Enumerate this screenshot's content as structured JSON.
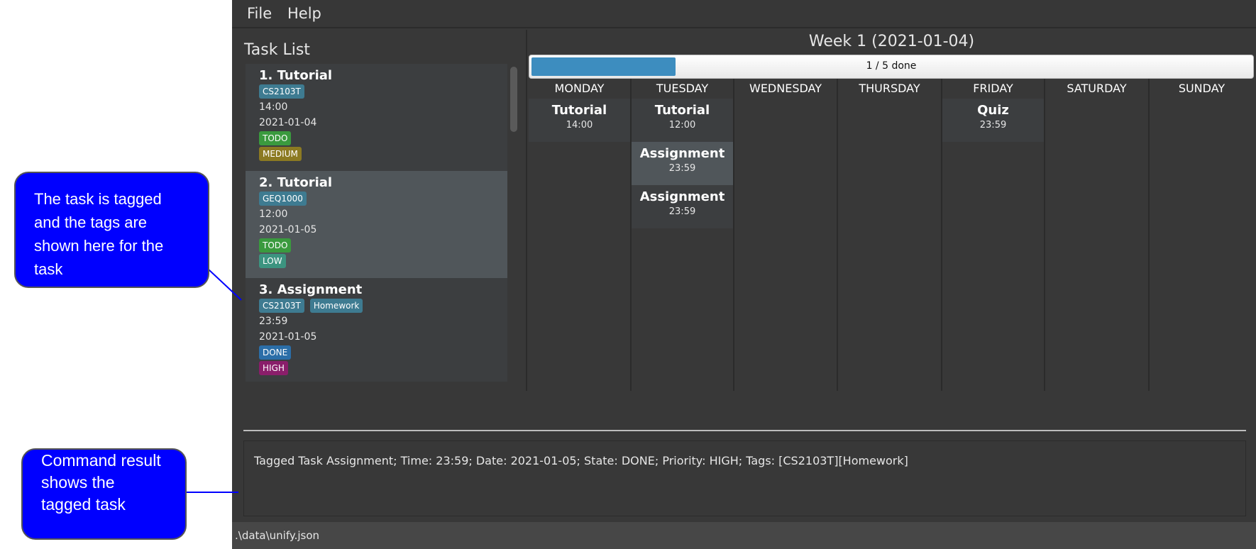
{
  "menu": {
    "file": "File",
    "help": "Help"
  },
  "task_list": {
    "title": "Task List",
    "tasks": [
      {
        "title": "1.  Tutorial",
        "tags": [
          "CS2103T"
        ],
        "time": "14:00",
        "date": "2021-01-04",
        "state": "TODO",
        "priority": "MEDIUM"
      },
      {
        "title": "2.  Tutorial",
        "tags": [
          "GEQ1000"
        ],
        "time": "12:00",
        "date": "2021-01-05",
        "state": "TODO",
        "priority": "LOW"
      },
      {
        "title": "3.  Assignment",
        "tags": [
          "CS2103T",
          "Homework"
        ],
        "time": "23:59",
        "date": "2021-01-05",
        "state": "DONE",
        "priority": "HIGH"
      }
    ]
  },
  "calendar": {
    "week_title": "Week 1 (2021-01-04)",
    "progress_text": "1 / 5 done",
    "progress_fraction": 0.2,
    "days": [
      {
        "name": "MONDAY",
        "events": [
          {
            "title": "Tutorial",
            "time": "14:00"
          }
        ]
      },
      {
        "name": "TUESDAY",
        "events": [
          {
            "title": "Tutorial",
            "time": "12:00"
          },
          {
            "title": "Assignment",
            "time": "23:59"
          },
          {
            "title": "Assignment",
            "time": "23:59"
          }
        ]
      },
      {
        "name": "WEDNESDAY",
        "events": []
      },
      {
        "name": "THURSDAY",
        "events": []
      },
      {
        "name": "FRIDAY",
        "events": [
          {
            "title": "Quiz",
            "time": "23:59"
          }
        ]
      },
      {
        "name": "SATURDAY",
        "events": []
      },
      {
        "name": "SUNDAY",
        "events": []
      }
    ]
  },
  "result": "Tagged Task Assignment; Time: 23:59; Date: 2021-01-05; State: DONE; Priority: HIGH; Tags: [CS2103T][Homework]",
  "status": ".\\data\\unify.json",
  "callouts": {
    "tags": "The task is tagged and the tags are shown here for the task",
    "result": "Command result shows the tagged task"
  },
  "colors": {
    "todo": "#3a9a3e",
    "done": "#2b6ea8",
    "medium": "#8c7a22",
    "low": "#3c9480",
    "high": "#8a1e6a",
    "tag": "#3e7b91",
    "progress": "#3d8dbf",
    "callout": "#0000ff"
  }
}
